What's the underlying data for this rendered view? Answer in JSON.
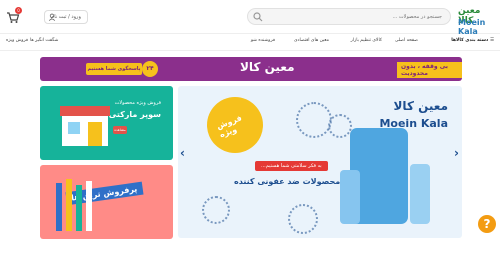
{
  "header": {
    "logo_fa": "معین کالا",
    "logo_en": "Moein Kala",
    "search_placeholder": "جستجو در محصولات ...",
    "login_label": "ورود / ثبت نام",
    "cart_count": "0"
  },
  "nav": {
    "categories": "دسته بندی کالاها",
    "items": [
      "صفحه اصلی",
      "کالای تنظیم بازار",
      "معین های اقتصادی",
      "فروشنده شو"
    ],
    "left_items": [
      "فروش ویژه",
      "شگفت انگیز ها"
    ]
  },
  "promo_strip": {
    "logo": "معین کالا",
    "right_text": "بی وقفه ، بدون محدودیت",
    "left_badge": "پاسخگوی شما هستیم",
    "number": "۲۴"
  },
  "side_cards": [
    {
      "title": "فروش ویژه محصولات",
      "big": "سوپر مارکتی",
      "button": "مشاهده"
    },
    {
      "big": "پرفروش ترین ها"
    }
  ],
  "main_banner": {
    "logo_fa": "معین کالا",
    "logo_en": "Moein Kala",
    "circle_text": "فروش ویژه",
    "tag": "به فکر سلامتی شما هستیم...",
    "title": "محصولات ضد عفونی کننده",
    "subtitle": "",
    "prev_arrow": "‹",
    "next_arrow": "›"
  },
  "help": "?"
}
